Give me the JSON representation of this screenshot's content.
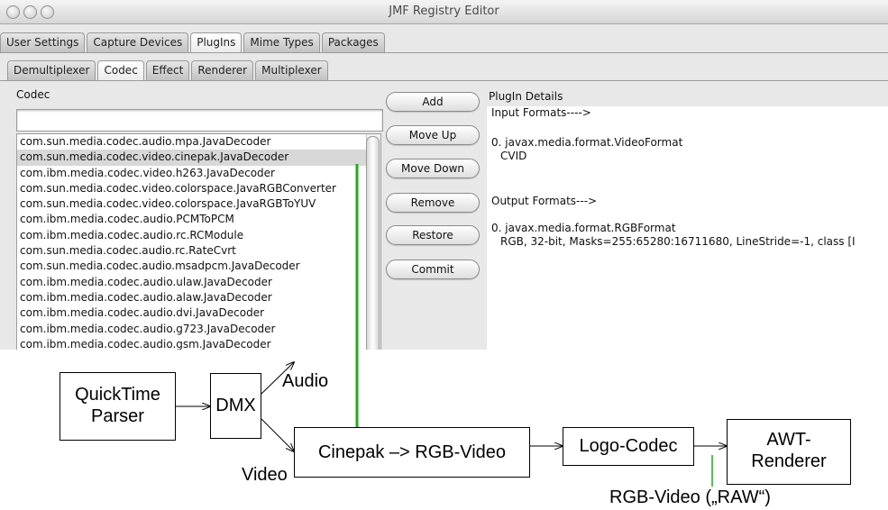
{
  "window": {
    "title": "JMF Registry Editor",
    "main_tabs": [
      "User Settings",
      "Capture Devices",
      "PlugIns",
      "Mime Types",
      "Packages"
    ],
    "active_main_tab": "PlugIns",
    "sub_tabs": [
      "Demultiplexer",
      "Codec",
      "Effect",
      "Renderer",
      "Multiplexer"
    ],
    "active_sub_tab": "Codec"
  },
  "codec_panel": {
    "label": "Codec",
    "input_value": "",
    "items": [
      "com.sun.media.codec.audio.mpa.JavaDecoder",
      "com.sun.media.codec.video.cinepak.JavaDecoder",
      "com.ibm.media.codec.video.h263.JavaDecoder",
      "com.sun.media.codec.video.colorspace.JavaRGBConverter",
      "com.sun.media.codec.video.colorspace.JavaRGBToYUV",
      "com.ibm.media.codec.audio.PCMToPCM",
      "com.ibm.media.codec.audio.rc.RCModule",
      "com.sun.media.codec.audio.rc.RateCvrt",
      "com.sun.media.codec.audio.msadpcm.JavaDecoder",
      "com.ibm.media.codec.audio.ulaw.JavaDecoder",
      "com.ibm.media.codec.audio.alaw.JavaDecoder",
      "com.ibm.media.codec.audio.dvi.JavaDecoder",
      "com.ibm.media.codec.audio.g723.JavaDecoder",
      "com.ibm.media.codec.audio.gsm.JavaDecoder"
    ],
    "selected_index": 1
  },
  "buttons": {
    "add": "Add",
    "move_up": "Move Up",
    "move_down": "Move Down",
    "remove": "Remove",
    "restore": "Restore",
    "commit": "Commit"
  },
  "details": {
    "label": "PlugIn Details",
    "input_header": "Input Formats---->",
    "input_format": "0. javax.media.format.VideoFormat",
    "input_encoding": "CVID",
    "output_header": "Output Formats--->",
    "output_format": "0. javax.media.format.RGBFormat",
    "output_params": "RGB, 32-bit, Masks=255:65280:16711680, LineStride=-1, class [I"
  },
  "diagram": {
    "quicktime_parser": [
      "QuickTime",
      "Parser"
    ],
    "dmx": "DMX",
    "audio": "Audio",
    "video": "Video",
    "cinepak": "Cinepak –> RGB-Video",
    "logo_codec": "Logo-Codec",
    "awt_renderer": [
      "AWT-",
      "Renderer"
    ],
    "raw_label": "RGB-Video („RAW“)",
    "highlight_color": "#22aa22"
  }
}
